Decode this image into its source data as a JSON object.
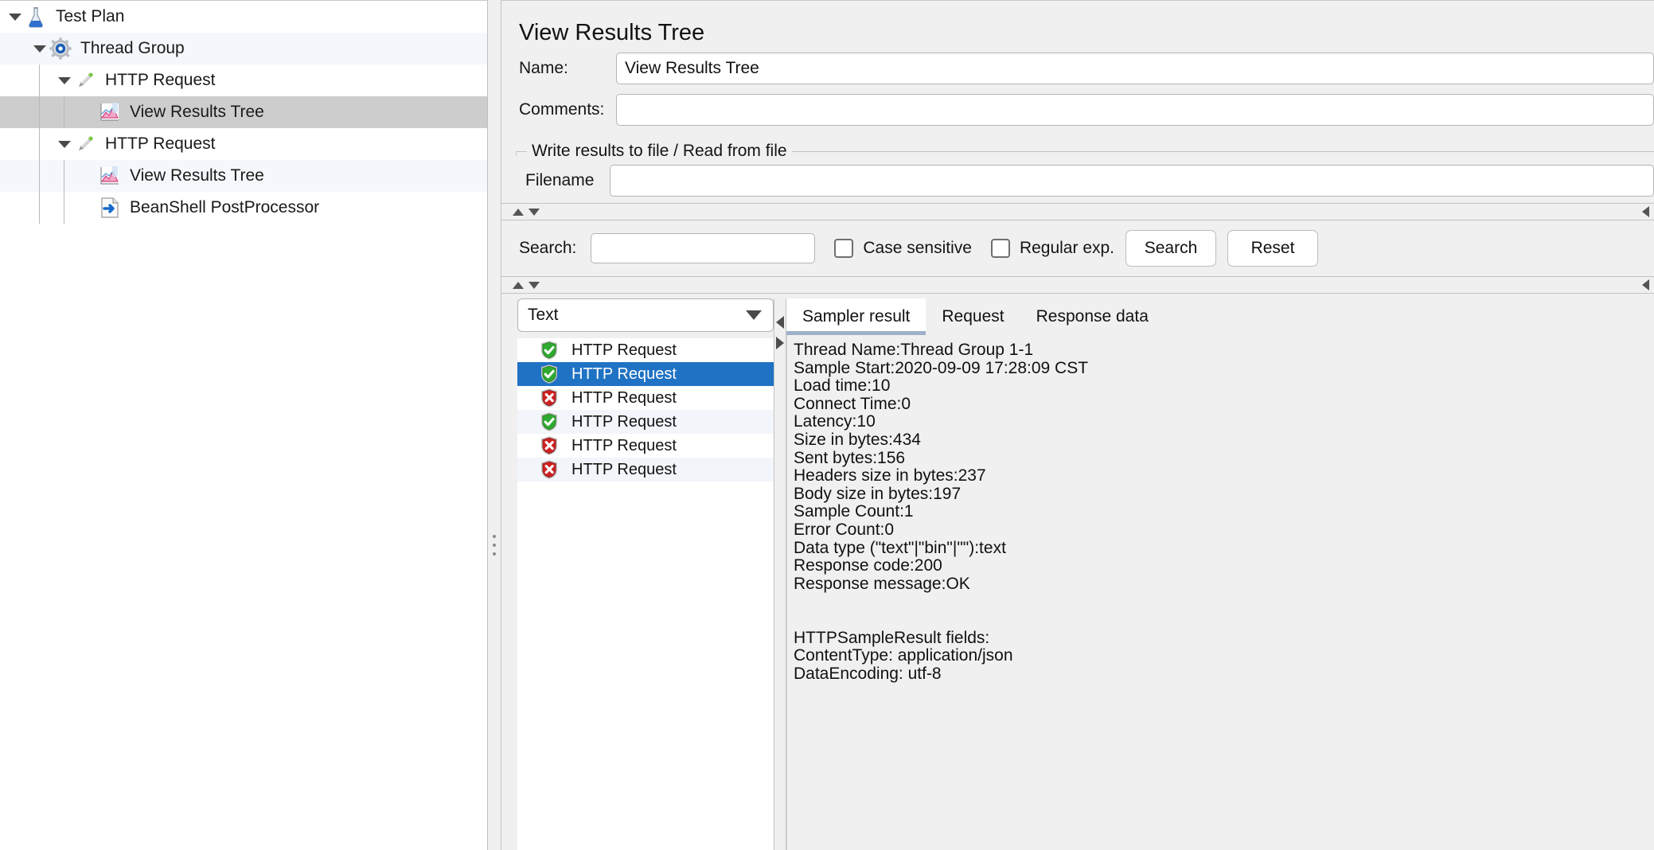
{
  "tree": {
    "nodes": [
      {
        "label": "Test Plan",
        "icon": "test-plan-icon",
        "depth": 0,
        "toggle": "expanded",
        "state": "normal"
      },
      {
        "label": "Thread Group",
        "icon": "thread-group-icon",
        "depth": 1,
        "toggle": "expanded",
        "state": "alt"
      },
      {
        "label": "HTTP Request",
        "icon": "http-request-icon",
        "depth": 2,
        "toggle": "expanded",
        "state": "normal"
      },
      {
        "label": "View Results Tree",
        "icon": "view-results-tree-icon",
        "depth": 3,
        "toggle": "none",
        "state": "selected"
      },
      {
        "label": "HTTP Request",
        "icon": "http-request-icon",
        "depth": 2,
        "toggle": "expanded",
        "state": "normal"
      },
      {
        "label": "View Results Tree",
        "icon": "view-results-tree-icon",
        "depth": 3,
        "toggle": "none",
        "state": "alt"
      },
      {
        "label": "BeanShell PostProcessor",
        "icon": "beanshell-postprocessor-icon",
        "depth": 3,
        "toggle": "none",
        "state": "normal"
      }
    ]
  },
  "panel": {
    "title": "View Results Tree",
    "name_label": "Name:",
    "name_value": "View Results Tree",
    "comments_label": "Comments:",
    "comments_value": "",
    "file_group_legend": "Write results to file / Read from file",
    "filename_label": "Filename",
    "filename_value": ""
  },
  "search": {
    "label": "Search:",
    "value": "",
    "case_sensitive_label": "Case sensitive",
    "case_sensitive_checked": false,
    "regular_exp_label": "Regular exp.",
    "regular_exp_checked": false,
    "search_button": "Search",
    "reset_button": "Reset"
  },
  "results": {
    "render_selector_value": "Text",
    "rows": [
      {
        "label": "HTTP Request",
        "status": "success",
        "selected": false,
        "alt": false
      },
      {
        "label": "HTTP Request",
        "status": "success",
        "selected": true,
        "alt": false
      },
      {
        "label": "HTTP Request",
        "status": "error",
        "selected": false,
        "alt": false
      },
      {
        "label": "HTTP Request",
        "status": "success",
        "selected": false,
        "alt": true
      },
      {
        "label": "HTTP Request",
        "status": "error",
        "selected": false,
        "alt": false
      },
      {
        "label": "HTTP Request",
        "status": "error",
        "selected": false,
        "alt": true
      }
    ]
  },
  "detail": {
    "tabs": [
      {
        "label": "Sampler result",
        "active": true
      },
      {
        "label": "Request",
        "active": false
      },
      {
        "label": "Response data",
        "active": false
      }
    ],
    "lines": [
      "Thread Name:Thread Group 1-1",
      "Sample Start:2020-09-09 17:28:09 CST",
      "Load time:10",
      "Connect Time:0",
      "Latency:10",
      "Size in bytes:434",
      "Sent bytes:156",
      "Headers size in bytes:237",
      "Body size in bytes:197",
      "Sample Count:1",
      "Error Count:0",
      "Data type (\"text\"|\"bin\"|\"\"):text",
      "Response code:200",
      "Response message:OK",
      "",
      "",
      "HTTPSampleResult fields:",
      "ContentType: application/json",
      "DataEncoding: utf-8"
    ]
  },
  "colors": {
    "selection_blue": "#1f72c4",
    "tree_selection_gray": "#cdcdcd",
    "alt_row": "#f2f5fa",
    "success_green": "#2faa2f",
    "error_red": "#cc2222",
    "panel_bg": "#f0f0f0",
    "tab_underline": "#9fb0c9"
  }
}
